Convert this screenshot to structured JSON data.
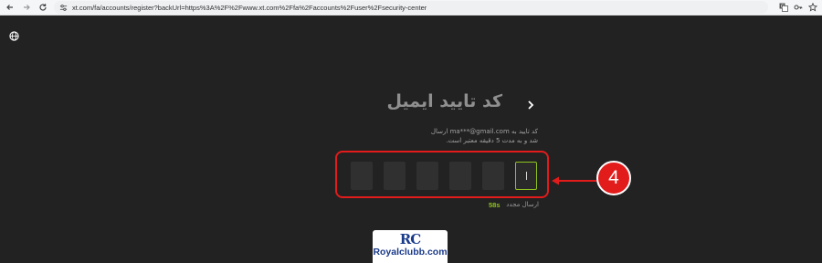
{
  "browser": {
    "url": "xt.com/fa/accounts/register?backUrl=https%3A%2F%2Fwww.xt.com%2Ffa%2Faccounts%2Fuser%2Fsecurity-center",
    "back_icon": "arrow-left-icon",
    "forward_icon": "arrow-right-icon",
    "reload_icon": "reload-icon",
    "site_settings_icon": "tune-icon",
    "translate_icon": "translate-icon",
    "password_icon": "key-icon",
    "bookmark_icon": "star-icon"
  },
  "page": {
    "language_icon": "globe-icon",
    "back_icon": "chevron-right-icon",
    "title": "کد تایید ایمیل",
    "description": "کد تایید به ma***@gmail.com ارسال شد و به مدت 5 دقیقه معتبر است.",
    "code_length": 6,
    "active_box_index": 5,
    "resend_label": "ارسال مجدد",
    "timer": "58s",
    "accent_color": "#8fc31f"
  },
  "annotation": {
    "step_number": "4",
    "color": "#e21b1b"
  },
  "watermark": {
    "logo_text": "RC",
    "domain": "Royalclubb.com"
  }
}
